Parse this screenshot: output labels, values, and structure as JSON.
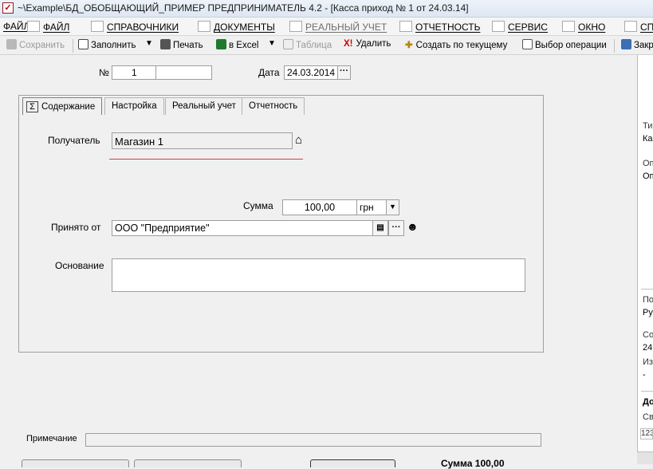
{
  "window": {
    "title": "~\\Example\\БД_ОБОБЩАЮЩИЙ_ПРИМЕР  ПРЕДПРИНИМАТЕЛЬ 4.2 - [Касса приход № 1 от 24.03.14]"
  },
  "menu": [
    {
      "label": "ФАЙЛ",
      "icon": "folder-icon"
    },
    {
      "label": "СПРАВОЧНИКИ",
      "icon": "home-icon"
    },
    {
      "label": "ДОКУМЕНТЫ",
      "icon": "document-icon"
    },
    {
      "label": "РЕАЛЬНЫЙ УЧЕТ",
      "icon": "ledger-icon"
    },
    {
      "label": "ОТЧЕТНОСТЬ",
      "icon": "report-icon"
    },
    {
      "label": "СЕРВИС",
      "icon": "service-icon"
    },
    {
      "label": "ОКНО",
      "icon": "window-icon"
    },
    {
      "label": "СП",
      "icon": "help-icon"
    }
  ],
  "toolbar": {
    "save": "Сохранить",
    "fill": "Заполнить",
    "print": "Печать",
    "excel": "в Excel",
    "table": "Таблица",
    "delete": "Удалить",
    "create_current": "Создать по текущему",
    "choose_operation": "Выбор операции",
    "close": "Закр"
  },
  "header": {
    "number_label": "№",
    "number_value": "1",
    "date_label": "Дата",
    "date_value": "24.03.2014"
  },
  "tabs": [
    {
      "label": "Содержание",
      "active": true
    },
    {
      "label": "Настройка",
      "active": false
    },
    {
      "label": "Реальный учет",
      "active": false
    },
    {
      "label": "Отчетность",
      "active": false
    }
  ],
  "form": {
    "recipient_label": "Получатель",
    "recipient_value": "Магазин 1",
    "sum_label": "Сумма",
    "sum_value": "100,00",
    "currency_value": "грн",
    "received_from_label": "Принято от",
    "received_from_value": "ООО \"Предприятие\"",
    "basis_label": "Основание",
    "basis_value": ""
  },
  "footer": {
    "note_label": "Примечание",
    "note_value": "",
    "total_partial": "Сумма   100,00"
  },
  "right_panel": [
    "Ти",
    "Ка",
    "Оп",
    "Оп",
    "По",
    "Ру",
    "Со",
    "24",
    "Из",
    "-",
    "До",
    "Св",
    "123"
  ],
  "colors": {
    "accent_underline": "#d04040",
    "field_border": "#9e9e9e",
    "background": "#f0f0f0"
  }
}
